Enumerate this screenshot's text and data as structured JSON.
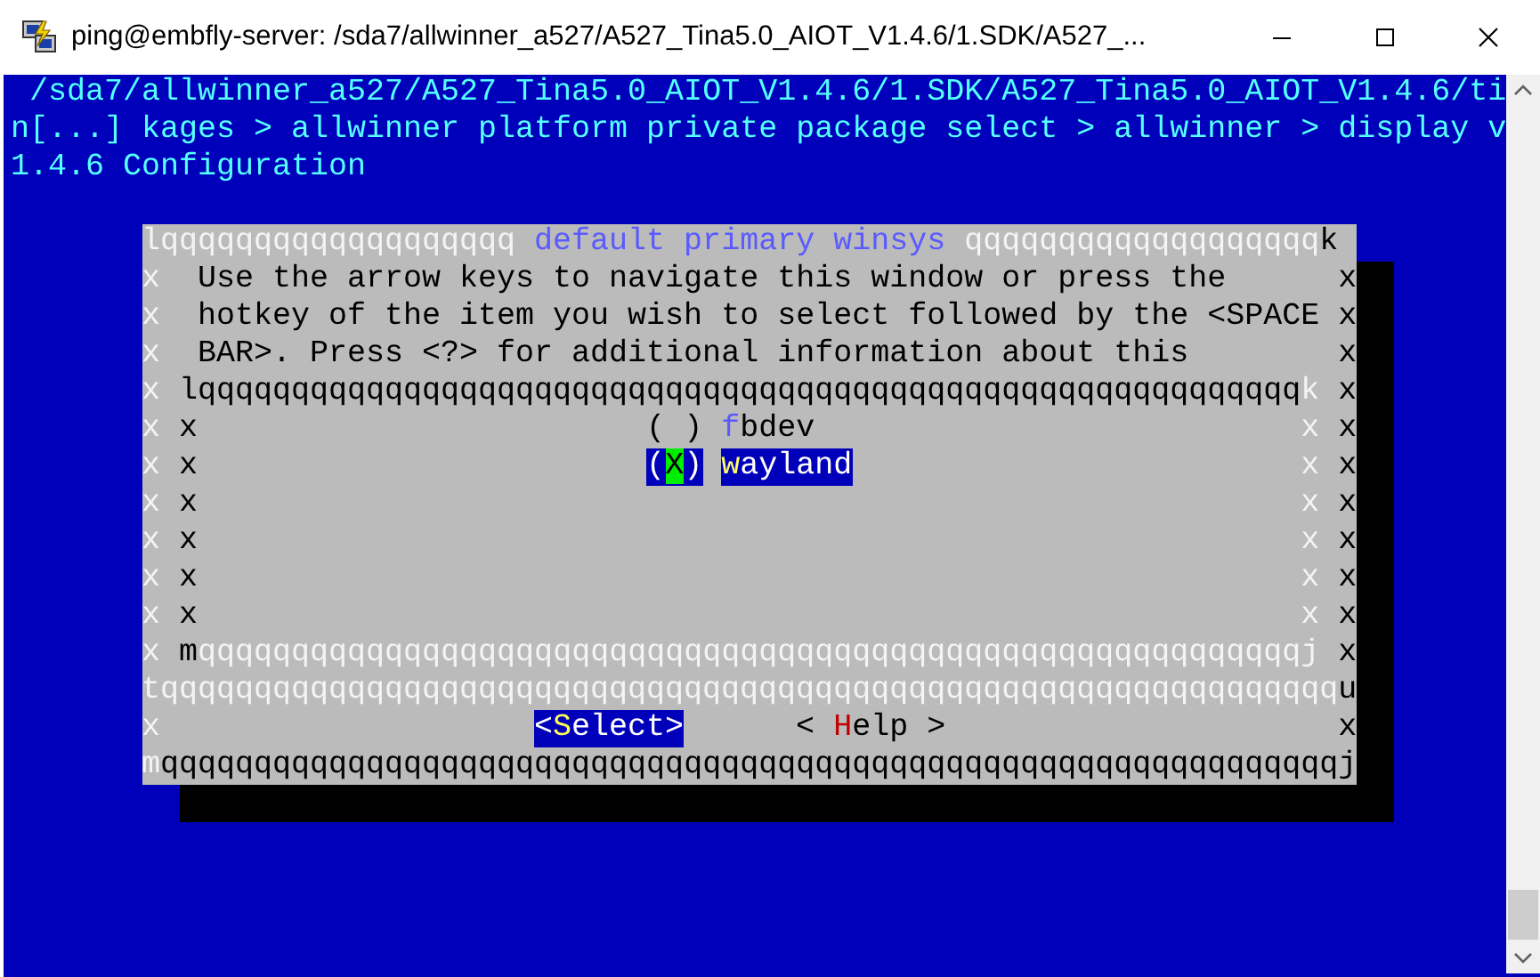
{
  "window": {
    "title": "ping@embfly-server: /sda7/allwinner_a527/A527_Tina5.0_AIOT_V1.4.6/1.SDK/A527_..."
  },
  "terminal": {
    "header_lines": [
      " /sda7/allwinner_a527/A527_Tina5.0_AIOT_V1.4.6/1.SDK/A527_Tina5.0_AIOT_V1.4.6/ti",
      "n[...] kages > allwinner platform private package select > allwinner > display v",
      "1.4.6 Configuration"
    ],
    "dialog": {
      "rows": [
        {
          "kind": "title",
          "left": "lqqqqqqqqqqqqqqqqqqq",
          "title": "default primary winsys",
          "right": "qqqqqqqqqqqqqqqqqqq",
          "corner": "k"
        },
        {
          "kind": "text",
          "edge_left": "x",
          "text": "Use the arrow keys to navigate this window or press the",
          "edge_right": "x"
        },
        {
          "kind": "text",
          "edge_left": "x",
          "text": "hotkey of the item you wish to select followed by the <SPACE",
          "edge_right": "x"
        },
        {
          "kind": "text",
          "edge_left": "x",
          "text": "BAR>. Press <?> for additional information about this",
          "edge_right": "x"
        },
        {
          "kind": "list_top",
          "edge_left": "x",
          "line": "lqqqqqqqqqqqqqqqqqqqqqqqqqqqqqqqqqqqqqqqqqqqqqqqqqqqqqqqqqqq",
          "corner": "k",
          "edge_right": "x"
        },
        {
          "kind": "list_row",
          "edge_left": "x",
          "inner_left": "x",
          "inner_right": "x",
          "edge_right": "x",
          "item": {
            "mark": "( )",
            "hotkey": "f",
            "label": "bdev",
            "selected": false
          }
        },
        {
          "kind": "list_row",
          "edge_left": "x",
          "inner_left": "x",
          "inner_right": "x",
          "edge_right": "x",
          "item": {
            "mark": "(X)",
            "hotkey": "w",
            "label": "ayland",
            "selected": true
          }
        },
        {
          "kind": "list_row",
          "edge_left": "x",
          "inner_left": "x",
          "inner_right": "x",
          "edge_right": "x"
        },
        {
          "kind": "list_row",
          "edge_left": "x",
          "inner_left": "x",
          "inner_right": "x",
          "edge_right": "x"
        },
        {
          "kind": "list_row",
          "edge_left": "x",
          "inner_left": "x",
          "inner_right": "x",
          "edge_right": "x"
        },
        {
          "kind": "list_row",
          "edge_left": "x",
          "inner_left": "x",
          "inner_right": "x",
          "edge_right": "x"
        },
        {
          "kind": "list_bottom",
          "edge_left": "x",
          "corner": "m",
          "line": "qqqqqqqqqqqqqqqqqqqqqqqqqqqqqqqqqqqqqqqqqqqqqqqqqqqqqqqqqqqj",
          "edge_right": "x"
        },
        {
          "kind": "divider",
          "line": "tqqqqqqqqqqqqqqqqqqqqqqqqqqqqqqqqqqqqqqqqqqqqqqqqqqqqqqqqqqqqqqq",
          "corner": "u"
        },
        {
          "kind": "buttons",
          "edge_left": "x",
          "buttons": [
            {
              "open": "<",
              "hotkey": "S",
              "label": "elect",
              "close": ">",
              "selected": true
            },
            {
              "open": "< ",
              "hotkey": "H",
              "label": "elp",
              "close": " >",
              "selected": false
            }
          ],
          "edge_right": "x"
        },
        {
          "kind": "bottom",
          "corner": "m",
          "line": "qqqqqqqqqqqqqqqqqqqqqqqqqqqqqqqqqqqqqqqqqqqqqqqqqqqqqqqqqqqqqqqj"
        }
      ]
    }
  }
}
